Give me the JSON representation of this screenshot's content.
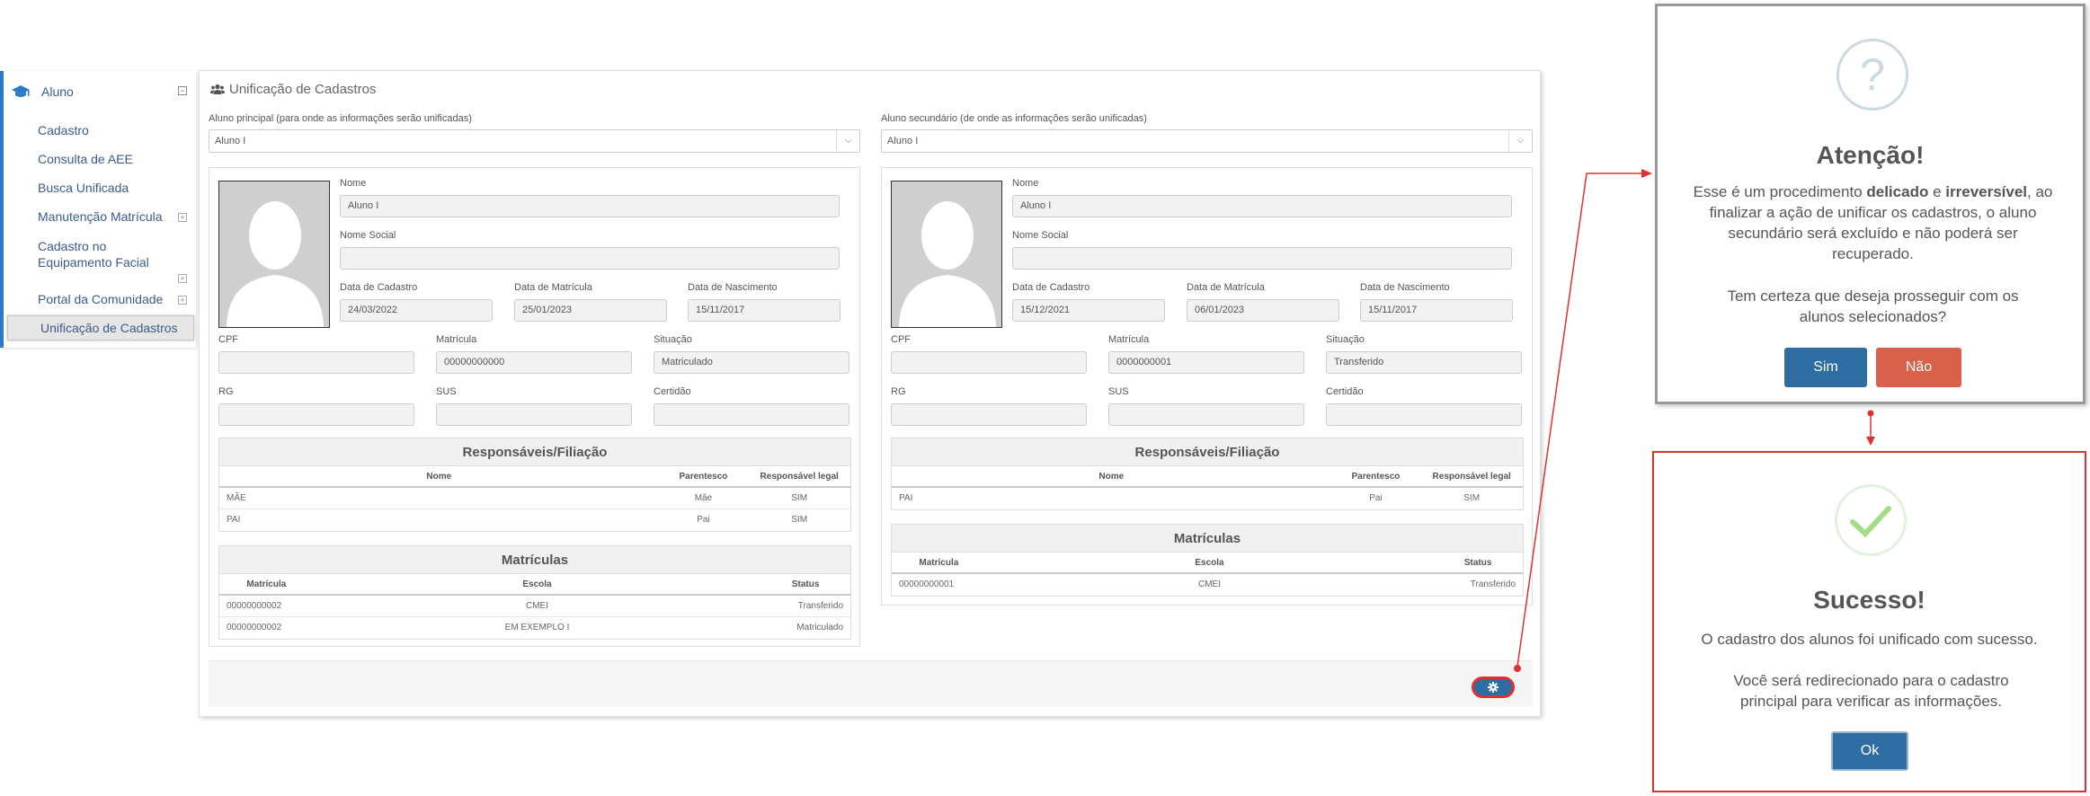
{
  "sidebar": {
    "module": "Aluno",
    "items": [
      "Cadastro",
      "Consulta de AEE",
      "Busca Unificada",
      "Manutenção Matrícula",
      "Cadastro no Equipamento Facial",
      "Portal da Comunidade"
    ],
    "active": "Unificação de Cadastros"
  },
  "panel": {
    "title": "Unificação de Cadastros"
  },
  "labels": {
    "nome": "Nome",
    "nome_social": "Nome Social",
    "data_cadastro": "Data de Cadastro",
    "data_matricula": "Data de Matrícula",
    "data_nascimento": "Data de Nascimento",
    "cpf": "CPF",
    "matricula": "Matrícula",
    "situacao": "Situação",
    "rg": "RG",
    "sus": "SUS",
    "certidao": "Certidão",
    "resp_title": "Responsáveis/Filiação",
    "resp_nome": "Nome",
    "resp_parentesco": "Parentesco",
    "resp_legal": "Responsável legal",
    "mat_title": "Matrículas",
    "mat_matricula": "Matrícula",
    "mat_escola": "Escola",
    "mat_status": "Status"
  },
  "primary": {
    "select_label": "Aluno principal (para onde as informações serão unificadas)",
    "select_value": "Aluno I",
    "nome": "Aluno I",
    "nome_social": "",
    "data_cadastro": "24/03/2022",
    "data_matricula": "25/01/2023",
    "data_nascimento": "15/11/2017",
    "cpf": "",
    "matricula": "00000000000",
    "situacao": "Matriculado",
    "rg": "",
    "sus": "",
    "certidao": "",
    "responsaveis": [
      {
        "nome": "MÃE",
        "parentesco": "Mãe",
        "legal": "SIM"
      },
      {
        "nome": "PAI",
        "parentesco": "Pai",
        "legal": "SIM"
      }
    ],
    "matriculas": [
      {
        "matricula": "00000000002",
        "escola": "CMEI",
        "status": "Transferido"
      },
      {
        "matricula": "00000000002",
        "escola": "EM EXEMPLO I",
        "status": "Matriculado"
      }
    ]
  },
  "secondary": {
    "select_label": "Aluno secundário (de onde as informações serão unificadas)",
    "select_value": "Aluno I",
    "nome": "Aluno I",
    "nome_social": "",
    "data_cadastro": "15/12/2021",
    "data_matricula": "06/01/2023",
    "data_nascimento": "15/11/2017",
    "cpf": "",
    "matricula": "0000000001",
    "situacao": "Transferido",
    "rg": "",
    "sus": "",
    "certidao": "",
    "responsaveis": [
      {
        "nome": "PAI",
        "parentesco": "Pai",
        "legal": "SIM"
      }
    ],
    "matriculas": [
      {
        "matricula": "00000000001",
        "escola": "CMEI",
        "status": "Transferido"
      }
    ]
  },
  "confirm_dialog": {
    "title": "Atenção!",
    "text_1": "Esse é um procedimento",
    "bold_1": "delicado",
    "text_2": "e",
    "bold_2": "irreversível",
    "text_3": ", ao finalizar a ação de unificar os cadastros, o aluno secundário será excluído e não poderá ser recuperado.",
    "question": "Tem certeza que deseja prosseguir com os alunos selecionados?",
    "yes": "Sim",
    "no": "Não"
  },
  "success_dialog": {
    "title": "Sucesso!",
    "text": "O cadastro dos alunos foi unificado com sucesso.",
    "text_2": "Você será redirecionado para o cadastro principal para verificar as informações.",
    "ok": "Ok"
  },
  "colors": {
    "primary_btn": "#2e6da4",
    "danger_btn": "#d9604a",
    "annotation_red": "#e03030",
    "sidebar_accent": "#2e78c8"
  }
}
